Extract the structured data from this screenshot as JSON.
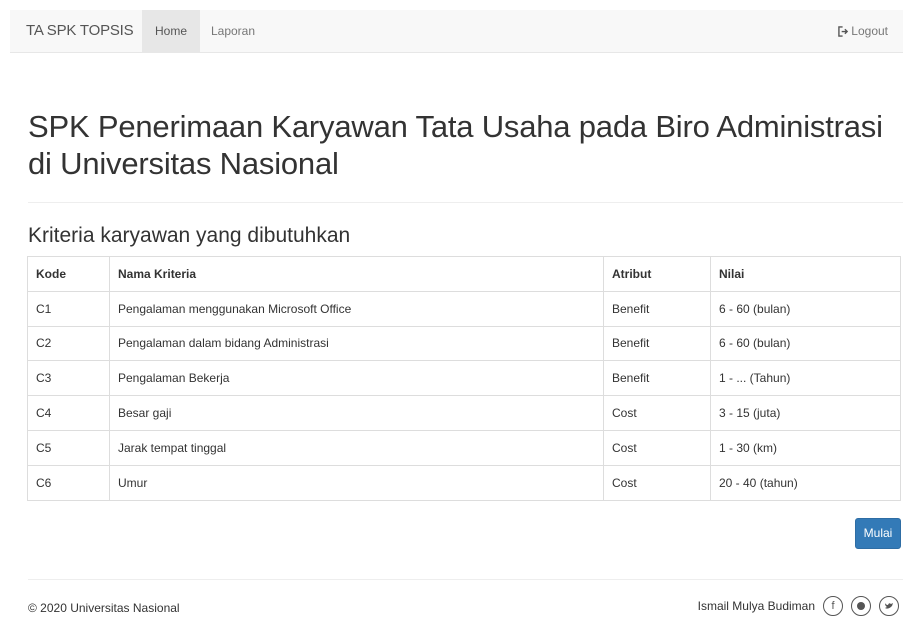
{
  "navbar": {
    "brand": "TA SPK TOPSIS",
    "links": [
      {
        "label": "Home",
        "active": true
      },
      {
        "label": "Laporan",
        "active": false
      }
    ],
    "logout_label": "Logout",
    "logout_icon": "logout-icon"
  },
  "page": {
    "title": "SPK Penerimaan Karyawan Tata Usaha pada Biro Administrasi di Universitas Nasional",
    "section_title": "Kriteria karyawan yang dibutuhkan"
  },
  "table": {
    "headers": [
      "Kode",
      "Nama Kriteria",
      "Atribut",
      "Nilai"
    ],
    "rows": [
      [
        "C1",
        "Pengalaman menggunakan Microsoft Office",
        "Benefit",
        "6 - 60 (bulan)"
      ],
      [
        "C2",
        "Pengalaman dalam bidang Administrasi",
        "Benefit",
        "6 - 60 (bulan)"
      ],
      [
        "C3",
        "Pengalaman Bekerja",
        "Benefit",
        "1 - ... (Tahun)"
      ],
      [
        "C4",
        "Besar gaji",
        "Cost",
        "3 - 15 (juta)"
      ],
      [
        "C5",
        "Jarak tempat tinggal",
        "Cost",
        "1 - 30 (km)"
      ],
      [
        "C6",
        "Umur",
        "Cost",
        "20 - 40 (tahun)"
      ]
    ]
  },
  "actions": {
    "start_label": "Mulai"
  },
  "footer": {
    "copyright": "© 2020  Universitas Nasional",
    "author": "Ismail Mulya Budiman",
    "social_icons": [
      "facebook-icon",
      "github-icon",
      "twitter-icon"
    ]
  },
  "colors": {
    "primary": "#337ab7",
    "navbar_bg": "#f8f8f8",
    "active_bg": "#e7e7e7",
    "border": "#dddddd"
  }
}
